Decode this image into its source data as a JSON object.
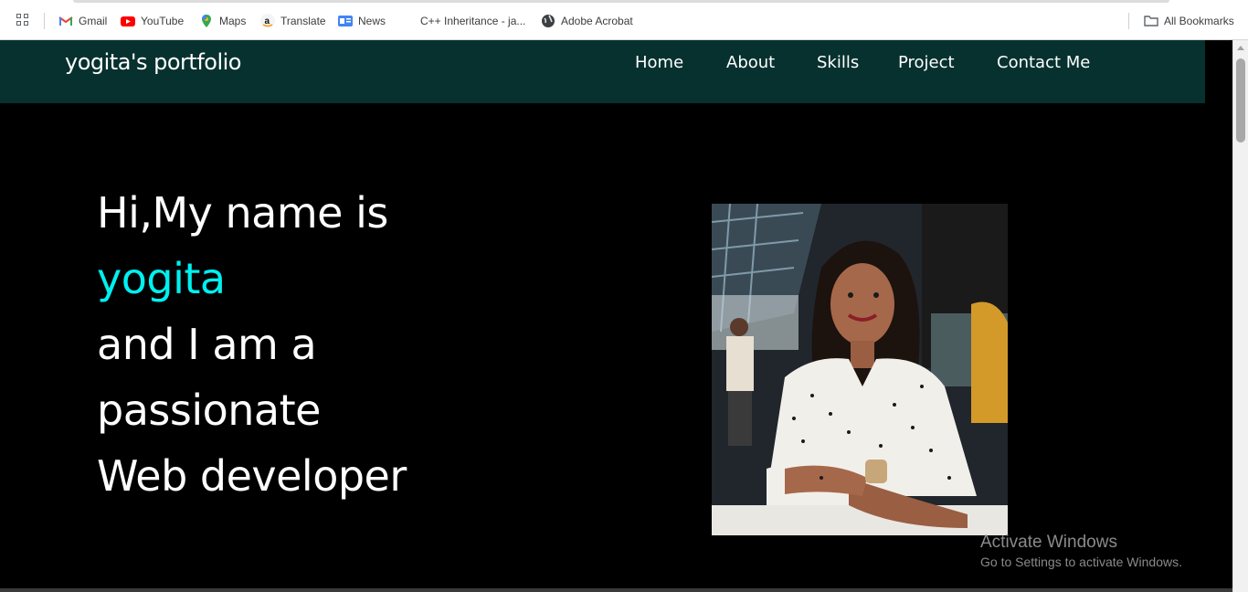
{
  "bookmarks": {
    "items": [
      {
        "label": "Gmail",
        "icon": "gmail-icon"
      },
      {
        "label": "YouTube",
        "icon": "youtube-icon"
      },
      {
        "label": "Maps",
        "icon": "maps-icon"
      },
      {
        "label": "Translate",
        "icon": "amazon-icon"
      },
      {
        "label": "News",
        "icon": "news-icon"
      },
      {
        "label": "C++ Inheritance - ja...",
        "icon": ""
      },
      {
        "label": "Adobe Acrobat",
        "icon": "globe-icon"
      }
    ],
    "all_bookmarks": "All Bookmarks"
  },
  "navbar": {
    "brand": "yogita's portfolio",
    "links": [
      "Home",
      "About",
      "Skills",
      "Project",
      "Contact Me"
    ],
    "bg_color": "#07312f"
  },
  "hero": {
    "line1": "Hi,My name is",
    "name": "yogita",
    "line3": "and I am a",
    "line4": "passionate",
    "line5": "Web developer",
    "accent_color": "#00f0f0"
  },
  "watermark": {
    "title": "Activate Windows",
    "subtitle": "Go to Settings to activate Windows."
  }
}
